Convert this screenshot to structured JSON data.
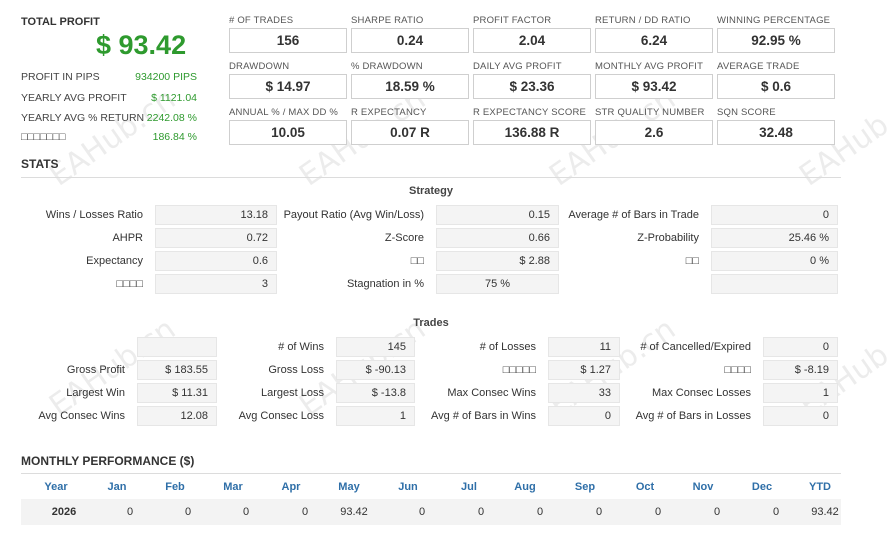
{
  "summary": {
    "total_profit_label": "TOTAL PROFIT",
    "total_profit_value": "$ 93.42",
    "rows": [
      {
        "label": "PROFIT IN PIPS",
        "value": "934200 PIPS"
      },
      {
        "label": "YEARLY AVG PROFIT",
        "value": "$ 1121.04"
      },
      {
        "label": "YEARLY AVG % RETURN",
        "value": "2242.08 %"
      },
      {
        "label": "□□□□□□□",
        "value": "186.84 %"
      }
    ]
  },
  "metrics": [
    {
      "label": "# OF TRADES",
      "value": "156"
    },
    {
      "label": "SHARPE RATIO",
      "value": "0.24"
    },
    {
      "label": "PROFIT FACTOR",
      "value": "2.04"
    },
    {
      "label": "RETURN / DD RATIO",
      "value": "6.24"
    },
    {
      "label": "WINNING PERCENTAGE",
      "value": "92.95 %"
    },
    {
      "label": "DRAWDOWN",
      "value": "$ 14.97"
    },
    {
      "label": "% DRAWDOWN",
      "value": "18.59 %"
    },
    {
      "label": "DAILY AVG PROFIT",
      "value": "$ 23.36"
    },
    {
      "label": "MONTHLY AVG PROFIT",
      "value": "$ 93.42"
    },
    {
      "label": "AVERAGE TRADE",
      "value": "$ 0.6"
    },
    {
      "label": "ANNUAL % / MAX DD %",
      "value": "10.05"
    },
    {
      "label": "R EXPECTANCY",
      "value": "0.07 R"
    },
    {
      "label": "R EXPECTANCY SCORE",
      "value": "136.88 R"
    },
    {
      "label": "STR QUALITY NUMBER",
      "value": "2.6"
    },
    {
      "label": "SQN SCORE",
      "value": "32.48"
    }
  ],
  "stats": {
    "title": "STATS",
    "strategy_title": "Strategy",
    "strategy_rows": [
      [
        {
          "label": "Wins / Losses Ratio",
          "value": "13.18"
        },
        {
          "label": "Payout Ratio (Avg Win/Loss)",
          "value": "0.15"
        },
        {
          "label": "Average # of Bars in Trade",
          "value": "0"
        }
      ],
      [
        {
          "label": "AHPR",
          "value": "0.72"
        },
        {
          "label": "Z-Score",
          "value": "0.66"
        },
        {
          "label": "Z-Probability",
          "value": "25.46 %"
        }
      ],
      [
        {
          "label": "Expectancy",
          "value": "0.6"
        },
        {
          "label": "□□",
          "value": "$ 2.88"
        },
        {
          "label": "□□",
          "value": "0 %"
        }
      ],
      [
        {
          "label": "□□□□",
          "value": "3"
        },
        {
          "label": "Stagnation in %",
          "value": "75 %"
        },
        {
          "label": "",
          "value": ""
        }
      ]
    ],
    "trades_title": "Trades",
    "trades_rows": [
      [
        {
          "label": "",
          "value": ""
        },
        {
          "label": "# of Wins",
          "value": "145"
        },
        {
          "label": "# of Losses",
          "value": "11"
        },
        {
          "label": "# of Cancelled/Expired",
          "value": "0"
        }
      ],
      [
        {
          "label": "Gross Profit",
          "value": "$ 183.55"
        },
        {
          "label": "Gross Loss",
          "value": "$ -90.13"
        },
        {
          "label": "□□□□□",
          "value": "$ 1.27"
        },
        {
          "label": "□□□□",
          "value": "$ -8.19"
        }
      ],
      [
        {
          "label": "Largest Win",
          "value": "$ 11.31"
        },
        {
          "label": "Largest Loss",
          "value": "$ -13.8"
        },
        {
          "label": "Max Consec Wins",
          "value": "33"
        },
        {
          "label": "Max Consec Losses",
          "value": "1"
        }
      ],
      [
        {
          "label": "Avg Consec Wins",
          "value": "12.08"
        },
        {
          "label": "Avg Consec Loss",
          "value": "1"
        },
        {
          "label": "Avg # of Bars in Wins",
          "value": "0"
        },
        {
          "label": "Avg # of Bars in Losses",
          "value": "0"
        }
      ]
    ]
  },
  "monthly": {
    "title": "MONTHLY PERFORMANCE ($)",
    "headers": [
      "Year",
      "Jan",
      "Feb",
      "Mar",
      "Apr",
      "May",
      "Jun",
      "Jul",
      "Aug",
      "Sep",
      "Oct",
      "Nov",
      "Dec",
      "YTD"
    ],
    "row": [
      "2026",
      "0",
      "0",
      "0",
      "0",
      "93.42",
      "0",
      "0",
      "0",
      "0",
      "0",
      "0",
      "0",
      "93.42"
    ]
  },
  "watermark": "EAHub.cn",
  "colors": {
    "profit_green": "#2e9a2e",
    "header_blue": "#2f6fa8"
  }
}
